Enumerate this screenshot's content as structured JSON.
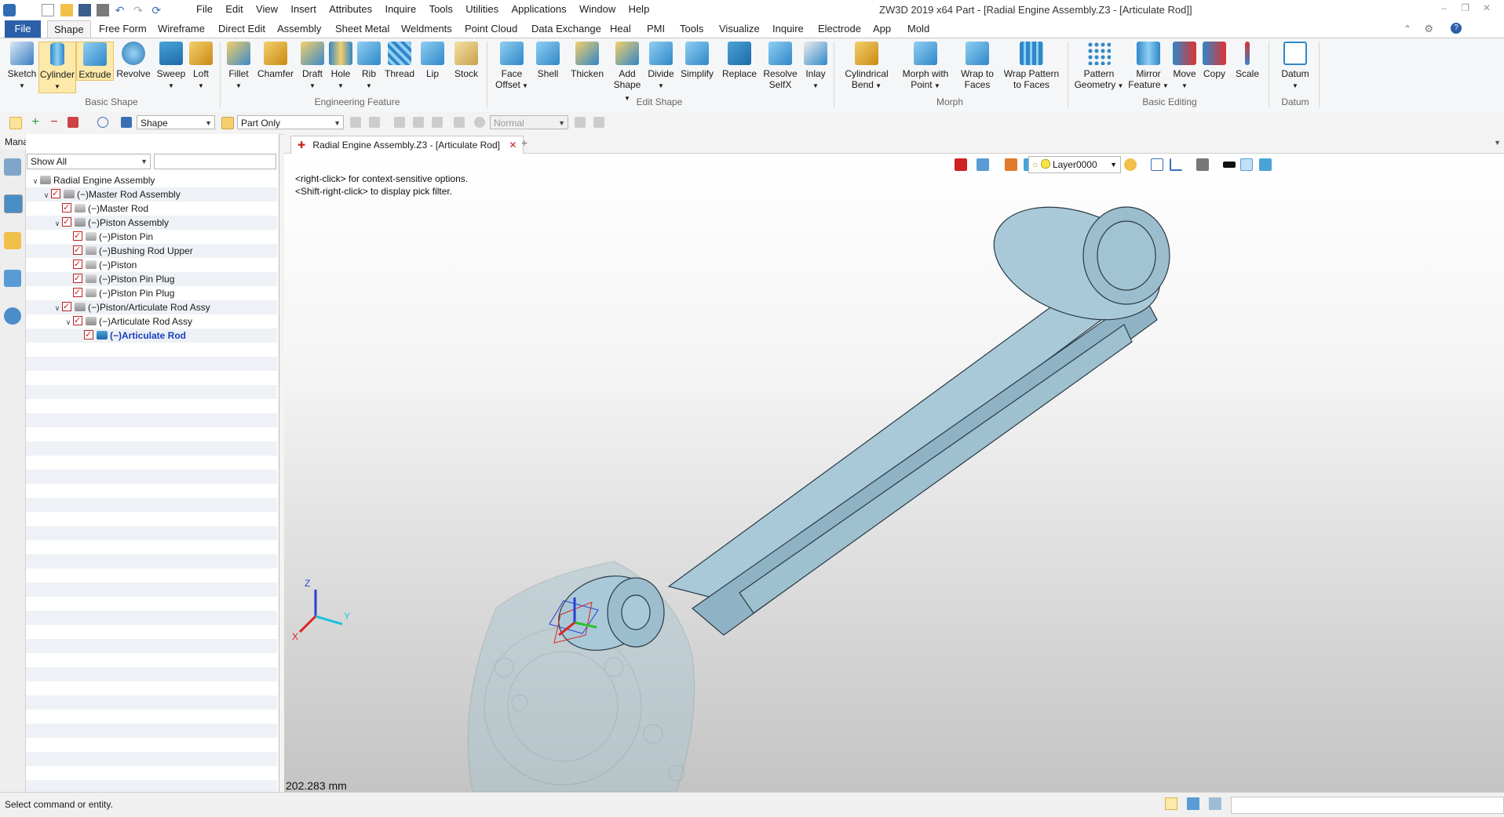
{
  "app": {
    "title": "ZW3D 2019  x64       Part - [Radial Engine Assembly.Z3 - [Articulate Rod]]",
    "menu": [
      "File",
      "Edit",
      "View",
      "Insert",
      "Attributes",
      "Inquire",
      "Tools",
      "Utilities",
      "Applications",
      "Window",
      "Help"
    ]
  },
  "ribbon": {
    "tabs": [
      "File",
      "Shape",
      "Free Form",
      "Wireframe",
      "Direct Edit",
      "Assembly",
      "Sheet Metal",
      "Weldments",
      "Point Cloud",
      "Data Exchange",
      "Heal",
      "PMI",
      "Tools",
      "Visualize",
      "Inquire",
      "Electrode",
      "App",
      "Mold"
    ],
    "active_tab": "Shape",
    "groups": {
      "basic_shape": "Basic Shape",
      "engineering_feature": "Engineering Feature",
      "edit_shape": "Edit Shape",
      "morph": "Morph",
      "basic_editing": "Basic Editing",
      "datum": "Datum"
    },
    "tools": {
      "sketch": "Sketch",
      "cylinder": "Cylinder",
      "extrude": "Extrude",
      "revolve": "Revolve",
      "sweep": "Sweep",
      "loft": "Loft",
      "fillet": "Fillet",
      "chamfer": "Chamfer",
      "draft": "Draft",
      "hole": "Hole",
      "rib": "Rib",
      "thread": "Thread",
      "lip": "Lip",
      "stock": "Stock",
      "face_offset_1": "Face",
      "face_offset_2": "Offset",
      "shell": "Shell",
      "thicken": "Thicken",
      "add_shape_1": "Add",
      "add_shape_2": "Shape",
      "divide": "Divide",
      "simplify": "Simplify",
      "replace": "Replace",
      "resolve_1": "Resolve",
      "resolve_2": "SelfX",
      "inlay": "Inlay",
      "cyl_bend_1": "Cylindrical",
      "cyl_bend_2": "Bend",
      "morph_point_1": "Morph with",
      "morph_point_2": "Point",
      "wrap_faces_1": "Wrap to",
      "wrap_faces_2": "Faces",
      "wrap_pattern_1": "Wrap Pattern",
      "wrap_pattern_2": "to Faces",
      "pattern_1": "Pattern",
      "pattern_2": "Geometry",
      "mirror_1": "Mirror",
      "mirror_2": "Feature",
      "move": "Move",
      "copy": "Copy",
      "scale": "Scale",
      "datum": "Datum"
    }
  },
  "toolbar2": {
    "filter": "Shape",
    "scope": "Part Only",
    "mode": "Normal"
  },
  "manager": {
    "title": "Manager",
    "show": "Show All",
    "tree": [
      {
        "label": "Radial Engine Assembly",
        "level": 0,
        "type": "asm",
        "check": false
      },
      {
        "label": "(−)Master Rod Assembly",
        "level": 1,
        "type": "asm",
        "check": true
      },
      {
        "label": "(−)Master Rod",
        "level": 2,
        "type": "part",
        "check": true
      },
      {
        "label": "(−)Piston Assembly",
        "level": 2,
        "type": "asm",
        "check": true
      },
      {
        "label": "(−)Piston Pin",
        "level": 3,
        "type": "part",
        "check": true
      },
      {
        "label": "(−)Bushing Rod Upper",
        "level": 3,
        "type": "part",
        "check": true
      },
      {
        "label": "(−)Piston",
        "level": 3,
        "type": "part",
        "check": true
      },
      {
        "label": "(−)Piston Pin Plug",
        "level": 3,
        "type": "part",
        "check": true
      },
      {
        "label": "(−)Piston Pin Plug",
        "level": 3,
        "type": "part",
        "check": true
      },
      {
        "label": "(−)Piston/Articulate Rod Assy",
        "level": 2,
        "type": "asm",
        "check": true
      },
      {
        "label": "(−)Articulate Rod Assy",
        "level": 3,
        "type": "asm",
        "check": true
      },
      {
        "label": "(−)Articulate Rod",
        "level": 4,
        "type": "act",
        "check": true
      }
    ]
  },
  "document": {
    "tab": "Radial Engine Assembly.Z3 - [Articulate Rod]",
    "hint1": "<right-click> for context-sensitive options.",
    "hint2": "<Shift-right-click> to display pick filter.",
    "layer": "Layer0000",
    "measure": "202.283 mm",
    "axis_x": "X",
    "axis_y": "Y",
    "axis_z": "Z"
  },
  "status": {
    "text": "Select command or entity."
  },
  "colors": {
    "accent": "#2b5fa8",
    "part_fill": "#9fc3d4",
    "part_edge": "#2a3a44"
  }
}
